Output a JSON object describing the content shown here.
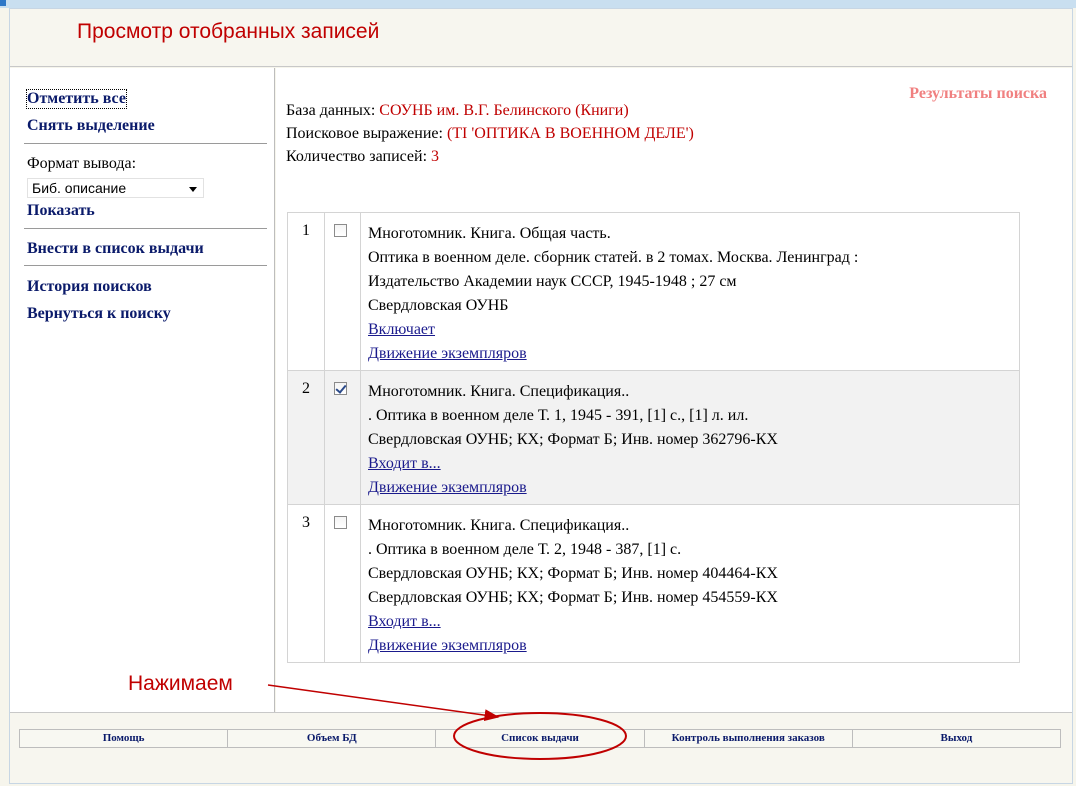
{
  "header": {
    "title": "Просмотр отобранных записей"
  },
  "sidebar": {
    "select_all": "Отметить все",
    "deselect": "Снять выделение",
    "format_label": "Формат вывода:",
    "format_value": "Биб. описание",
    "show": "Показать",
    "add_to_list": "Внести в список выдачи",
    "history": "История поисков",
    "back": "Вернуться к поиску"
  },
  "main": {
    "results_title": "Результаты поиска",
    "db_label": "База данных:",
    "db_value": "СОУНБ им. В.Г. Белинского (Книги)",
    "query_label": "Поисковое выражение:",
    "query_value": "(TI 'ОПТИКА В ВОЕННОМ ДЕЛЕ')",
    "count_label": "Количество записей:",
    "count_value": "3",
    "records": [
      {
        "num": "1",
        "checked": false,
        "lines": [
          "Многотомник. Книга. Общая часть.",
          "Оптика в военном деле. сборник статей. в 2 томах. Москва. Ленинград :",
          "Издательство Академии наук СССР, 1945-1948 ; 27 см",
          "Свердловская ОУНБ"
        ],
        "link1": "Включает",
        "link2": "Движение экземпляров"
      },
      {
        "num": "2",
        "checked": true,
        "lines": [
          "Многотомник. Книга. Спецификация..",
          ". Оптика в военном деле Т. 1, 1945 - 391, [1] с., [1] л. ил.",
          "Свердловская ОУНБ; КХ; Формат Б; Инв. номер 362796-КХ"
        ],
        "link1": "Входит в...",
        "link2": "Движение экземпляров"
      },
      {
        "num": "3",
        "checked": false,
        "lines": [
          "Многотомник. Книга. Спецификация..",
          ". Оптика в военном деле Т. 2, 1948 - 387, [1] с.",
          "Свердловская ОУНБ; КХ; Формат Б; Инв. номер 404464-КХ",
          "Свердловская ОУНБ; КХ; Формат Б; Инв. номер 454559-КХ"
        ],
        "link1": "Входит в...",
        "link2": "Движение экземпляров"
      }
    ]
  },
  "footer": {
    "nav": [
      "Помощь",
      "Объем БД",
      "Список выдачи",
      "Контроль выполнения заказов",
      "Выход"
    ]
  },
  "annotation": {
    "label": "Нажимаем",
    "color": "#c00000"
  }
}
